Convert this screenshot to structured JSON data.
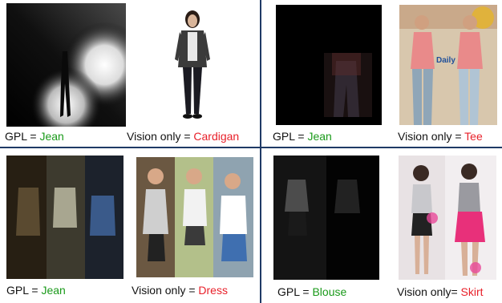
{
  "colors": {
    "correct": "#1a9a1a",
    "wrong": "#e8202a",
    "divider": "#1f3a66"
  },
  "panels": [
    {
      "gpl": {
        "prefix": "GPL = ",
        "value": "Jean"
      },
      "vision": {
        "prefix": "Vision only = ",
        "value": "Cardigan"
      }
    },
    {
      "gpl": {
        "prefix": "GPL = ",
        "value": "Jean"
      },
      "vision": {
        "prefix": "Vision only = ",
        "value": "Tee"
      },
      "image_text": [
        "Daily"
      ]
    },
    {
      "gpl": {
        "prefix": "GPL = ",
        "value": "Jean"
      },
      "vision": {
        "prefix": "Vision only = ",
        "value": "Dress"
      }
    },
    {
      "gpl": {
        "prefix": "GPL = ",
        "value": "Blouse"
      },
      "vision": {
        "prefix": "Vision only= ",
        "value": "Skirt"
      }
    }
  ]
}
